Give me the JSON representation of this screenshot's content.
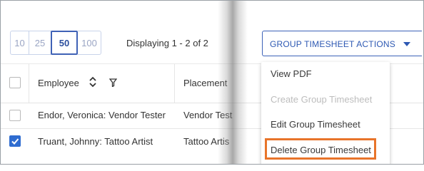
{
  "pager": {
    "sizes": [
      "10",
      "25",
      "50",
      "100"
    ],
    "active": "50",
    "displaying": "Displaying 1 - 2 of 2"
  },
  "actions": {
    "label": "GROUP TIMESHEET ACTIONS",
    "menu": [
      {
        "label": "View PDF",
        "enabled": true
      },
      {
        "label": "Create Group Timesheet",
        "enabled": false
      },
      {
        "label": "Edit Group Timesheet",
        "enabled": true
      },
      {
        "label": "Delete Group Timesheet",
        "enabled": true,
        "highlighted": true
      }
    ]
  },
  "table": {
    "columns": [
      "Employee",
      "Placement"
    ],
    "rows": [
      {
        "employee": "Endor, Veronica: Vendor Tester",
        "placement": "Vendor Test",
        "checked": false
      },
      {
        "employee": "Truant, Johnny: Tattoo Artist",
        "placement": "Tattoo Artis",
        "checked": true
      }
    ]
  },
  "colors": {
    "accent": "#2e59b3",
    "checkbox_checked": "#2f6cd0",
    "highlight_border": "#e8742a"
  }
}
